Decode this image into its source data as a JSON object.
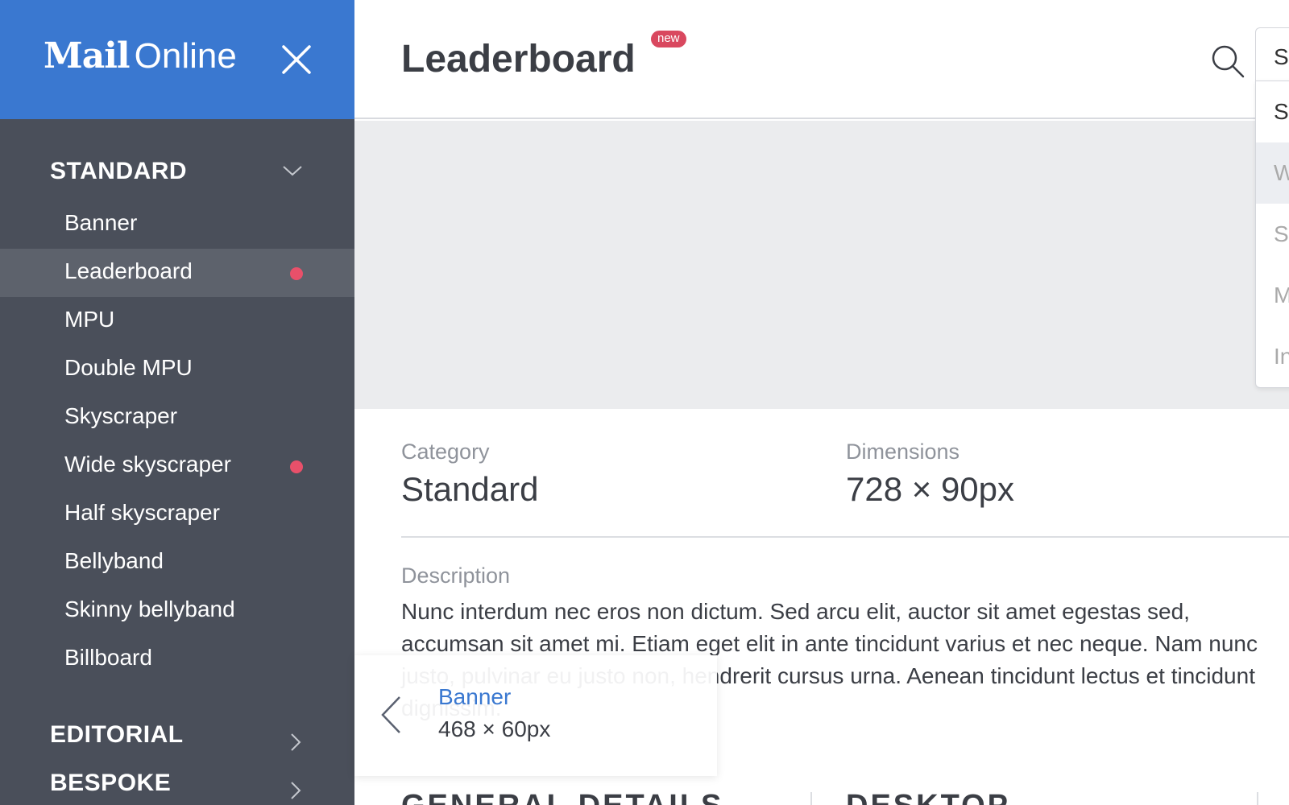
{
  "brand": {
    "mail": "Mail",
    "online": "Online"
  },
  "sidebar": {
    "sections": [
      {
        "label": "STANDARD",
        "expanded": true
      },
      {
        "label": "EDITORIAL",
        "expanded": false
      },
      {
        "label": "BESPOKE",
        "expanded": false
      }
    ],
    "items": [
      {
        "label": "Banner",
        "active": false,
        "dot": false
      },
      {
        "label": "Leaderboard",
        "active": true,
        "dot": true
      },
      {
        "label": "MPU",
        "active": false,
        "dot": false
      },
      {
        "label": "Double MPU",
        "active": false,
        "dot": false
      },
      {
        "label": "Skyscraper",
        "active": false,
        "dot": false
      },
      {
        "label": "Wide skyscraper",
        "active": false,
        "dot": true
      },
      {
        "label": "Half skyscraper",
        "active": false,
        "dot": false
      },
      {
        "label": "Bellyband",
        "active": false,
        "dot": false
      },
      {
        "label": "Skinny bellyband",
        "active": false,
        "dot": false
      },
      {
        "label": "Billboard",
        "active": false,
        "dot": false
      }
    ]
  },
  "header": {
    "title": "Leaderboard",
    "badge": "new"
  },
  "dropdown": {
    "selected": "Sl",
    "options": [
      "Sl",
      "W",
      "Sc",
      "M",
      "In"
    ]
  },
  "details": {
    "category_label": "Category",
    "category_value": "Standard",
    "dimensions_label": "Dimensions",
    "dimensions_value": "728 × 90px",
    "description_label": "Description",
    "description_text": "Nunc interdum nec eros non dictum. Sed arcu elit, auctor sit amet egestas sed, accumsan sit amet mi. Etiam eget elit in ante tincidunt varius et nec neque. Nam nunc justo, pulvinar eu justo non, hendrerit cursus urna. Aenean tincidunt lectus et tincidunt dignissim."
  },
  "sections_below": [
    "GENERAL DETAILS",
    "DESKTOP"
  ],
  "prev_card": {
    "title": "Banner",
    "subtitle": "468 × 60px"
  },
  "colors": {
    "brand_blue": "#3a78d0",
    "sidebar": "#4a4f5a",
    "sidebar_active": "#5d626c",
    "dot_red": "#e8506a",
    "badge_red": "#d9485f"
  },
  "icons": {
    "close": "close-icon",
    "search": "search-icon",
    "chevron_down": "chevron-down-icon",
    "chevron_right": "chevron-right-icon",
    "chevron_left": "chevron-left-icon"
  }
}
